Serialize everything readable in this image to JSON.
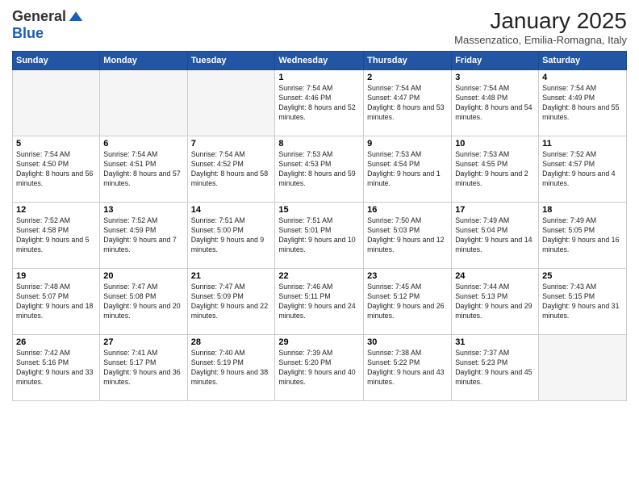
{
  "logo": {
    "general": "General",
    "blue": "Blue"
  },
  "title": "January 2025",
  "subtitle": "Massenzatico, Emilia-Romagna, Italy",
  "days_of_week": [
    "Sunday",
    "Monday",
    "Tuesday",
    "Wednesday",
    "Thursday",
    "Friday",
    "Saturday"
  ],
  "weeks": [
    [
      {
        "day": "",
        "sunrise": "",
        "sunset": "",
        "daylight": ""
      },
      {
        "day": "",
        "sunrise": "",
        "sunset": "",
        "daylight": ""
      },
      {
        "day": "",
        "sunrise": "",
        "sunset": "",
        "daylight": ""
      },
      {
        "day": "1",
        "sunrise": "Sunrise: 7:54 AM",
        "sunset": "Sunset: 4:46 PM",
        "daylight": "Daylight: 8 hours and 52 minutes."
      },
      {
        "day": "2",
        "sunrise": "Sunrise: 7:54 AM",
        "sunset": "Sunset: 4:47 PM",
        "daylight": "Daylight: 8 hours and 53 minutes."
      },
      {
        "day": "3",
        "sunrise": "Sunrise: 7:54 AM",
        "sunset": "Sunset: 4:48 PM",
        "daylight": "Daylight: 8 hours and 54 minutes."
      },
      {
        "day": "4",
        "sunrise": "Sunrise: 7:54 AM",
        "sunset": "Sunset: 4:49 PM",
        "daylight": "Daylight: 8 hours and 55 minutes."
      }
    ],
    [
      {
        "day": "5",
        "sunrise": "Sunrise: 7:54 AM",
        "sunset": "Sunset: 4:50 PM",
        "daylight": "Daylight: 8 hours and 56 minutes."
      },
      {
        "day": "6",
        "sunrise": "Sunrise: 7:54 AM",
        "sunset": "Sunset: 4:51 PM",
        "daylight": "Daylight: 8 hours and 57 minutes."
      },
      {
        "day": "7",
        "sunrise": "Sunrise: 7:54 AM",
        "sunset": "Sunset: 4:52 PM",
        "daylight": "Daylight: 8 hours and 58 minutes."
      },
      {
        "day": "8",
        "sunrise": "Sunrise: 7:53 AM",
        "sunset": "Sunset: 4:53 PM",
        "daylight": "Daylight: 8 hours and 59 minutes."
      },
      {
        "day": "9",
        "sunrise": "Sunrise: 7:53 AM",
        "sunset": "Sunset: 4:54 PM",
        "daylight": "Daylight: 9 hours and 1 minute."
      },
      {
        "day": "10",
        "sunrise": "Sunrise: 7:53 AM",
        "sunset": "Sunset: 4:55 PM",
        "daylight": "Daylight: 9 hours and 2 minutes."
      },
      {
        "day": "11",
        "sunrise": "Sunrise: 7:52 AM",
        "sunset": "Sunset: 4:57 PM",
        "daylight": "Daylight: 9 hours and 4 minutes."
      }
    ],
    [
      {
        "day": "12",
        "sunrise": "Sunrise: 7:52 AM",
        "sunset": "Sunset: 4:58 PM",
        "daylight": "Daylight: 9 hours and 5 minutes."
      },
      {
        "day": "13",
        "sunrise": "Sunrise: 7:52 AM",
        "sunset": "Sunset: 4:59 PM",
        "daylight": "Daylight: 9 hours and 7 minutes."
      },
      {
        "day": "14",
        "sunrise": "Sunrise: 7:51 AM",
        "sunset": "Sunset: 5:00 PM",
        "daylight": "Daylight: 9 hours and 9 minutes."
      },
      {
        "day": "15",
        "sunrise": "Sunrise: 7:51 AM",
        "sunset": "Sunset: 5:01 PM",
        "daylight": "Daylight: 9 hours and 10 minutes."
      },
      {
        "day": "16",
        "sunrise": "Sunrise: 7:50 AM",
        "sunset": "Sunset: 5:03 PM",
        "daylight": "Daylight: 9 hours and 12 minutes."
      },
      {
        "day": "17",
        "sunrise": "Sunrise: 7:49 AM",
        "sunset": "Sunset: 5:04 PM",
        "daylight": "Daylight: 9 hours and 14 minutes."
      },
      {
        "day": "18",
        "sunrise": "Sunrise: 7:49 AM",
        "sunset": "Sunset: 5:05 PM",
        "daylight": "Daylight: 9 hours and 16 minutes."
      }
    ],
    [
      {
        "day": "19",
        "sunrise": "Sunrise: 7:48 AM",
        "sunset": "Sunset: 5:07 PM",
        "daylight": "Daylight: 9 hours and 18 minutes."
      },
      {
        "day": "20",
        "sunrise": "Sunrise: 7:47 AM",
        "sunset": "Sunset: 5:08 PM",
        "daylight": "Daylight: 9 hours and 20 minutes."
      },
      {
        "day": "21",
        "sunrise": "Sunrise: 7:47 AM",
        "sunset": "Sunset: 5:09 PM",
        "daylight": "Daylight: 9 hours and 22 minutes."
      },
      {
        "day": "22",
        "sunrise": "Sunrise: 7:46 AM",
        "sunset": "Sunset: 5:11 PM",
        "daylight": "Daylight: 9 hours and 24 minutes."
      },
      {
        "day": "23",
        "sunrise": "Sunrise: 7:45 AM",
        "sunset": "Sunset: 5:12 PM",
        "daylight": "Daylight: 9 hours and 26 minutes."
      },
      {
        "day": "24",
        "sunrise": "Sunrise: 7:44 AM",
        "sunset": "Sunset: 5:13 PM",
        "daylight": "Daylight: 9 hours and 29 minutes."
      },
      {
        "day": "25",
        "sunrise": "Sunrise: 7:43 AM",
        "sunset": "Sunset: 5:15 PM",
        "daylight": "Daylight: 9 hours and 31 minutes."
      }
    ],
    [
      {
        "day": "26",
        "sunrise": "Sunrise: 7:42 AM",
        "sunset": "Sunset: 5:16 PM",
        "daylight": "Daylight: 9 hours and 33 minutes."
      },
      {
        "day": "27",
        "sunrise": "Sunrise: 7:41 AM",
        "sunset": "Sunset: 5:17 PM",
        "daylight": "Daylight: 9 hours and 36 minutes."
      },
      {
        "day": "28",
        "sunrise": "Sunrise: 7:40 AM",
        "sunset": "Sunset: 5:19 PM",
        "daylight": "Daylight: 9 hours and 38 minutes."
      },
      {
        "day": "29",
        "sunrise": "Sunrise: 7:39 AM",
        "sunset": "Sunset: 5:20 PM",
        "daylight": "Daylight: 9 hours and 40 minutes."
      },
      {
        "day": "30",
        "sunrise": "Sunrise: 7:38 AM",
        "sunset": "Sunset: 5:22 PM",
        "daylight": "Daylight: 9 hours and 43 minutes."
      },
      {
        "day": "31",
        "sunrise": "Sunrise: 7:37 AM",
        "sunset": "Sunset: 5:23 PM",
        "daylight": "Daylight: 9 hours and 45 minutes."
      },
      {
        "day": "",
        "sunrise": "",
        "sunset": "",
        "daylight": ""
      }
    ]
  ]
}
